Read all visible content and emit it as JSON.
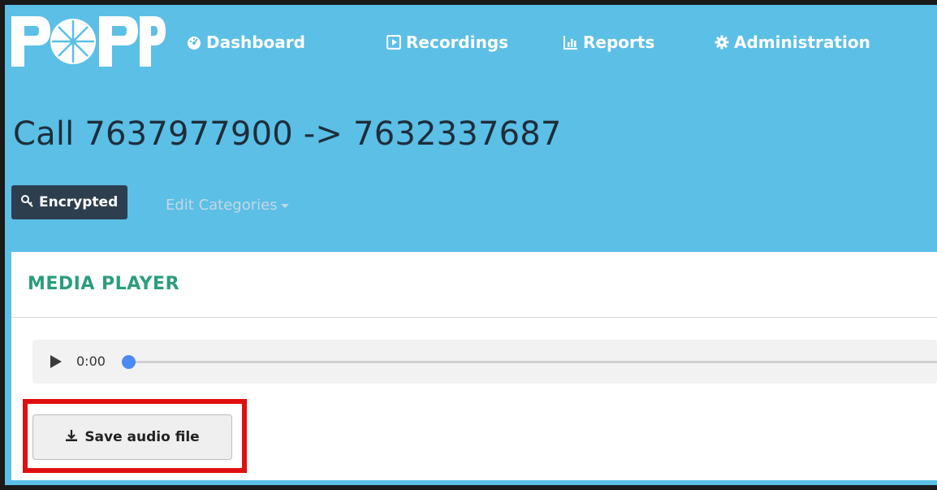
{
  "app": {
    "logo_text": "POPP",
    "brand_color": "#5bbfe6"
  },
  "nav": {
    "items": [
      {
        "label": "Dashboard",
        "icon": "tachometer-icon"
      },
      {
        "label": "Recordings",
        "icon": "play-square-icon"
      },
      {
        "label": "Reports",
        "icon": "bar-chart-icon"
      },
      {
        "label": "Administration",
        "icon": "gear-icon"
      }
    ]
  },
  "page": {
    "title": "Call 7637977900 -> 7632337687",
    "badge": {
      "label": "Encrypted",
      "icon": "key-icon"
    },
    "edit_categories_label": "Edit Categories"
  },
  "panel": {
    "title": "MEDIA PLAYER",
    "player": {
      "time": "0:00",
      "progress": 0
    },
    "save_button_label": "Save audio file",
    "save_button_icon": "download-icon"
  },
  "colors": {
    "heading_accent": "#2a9d7e",
    "badge_bg": "#2d3e4f",
    "highlight": "#e01010"
  }
}
